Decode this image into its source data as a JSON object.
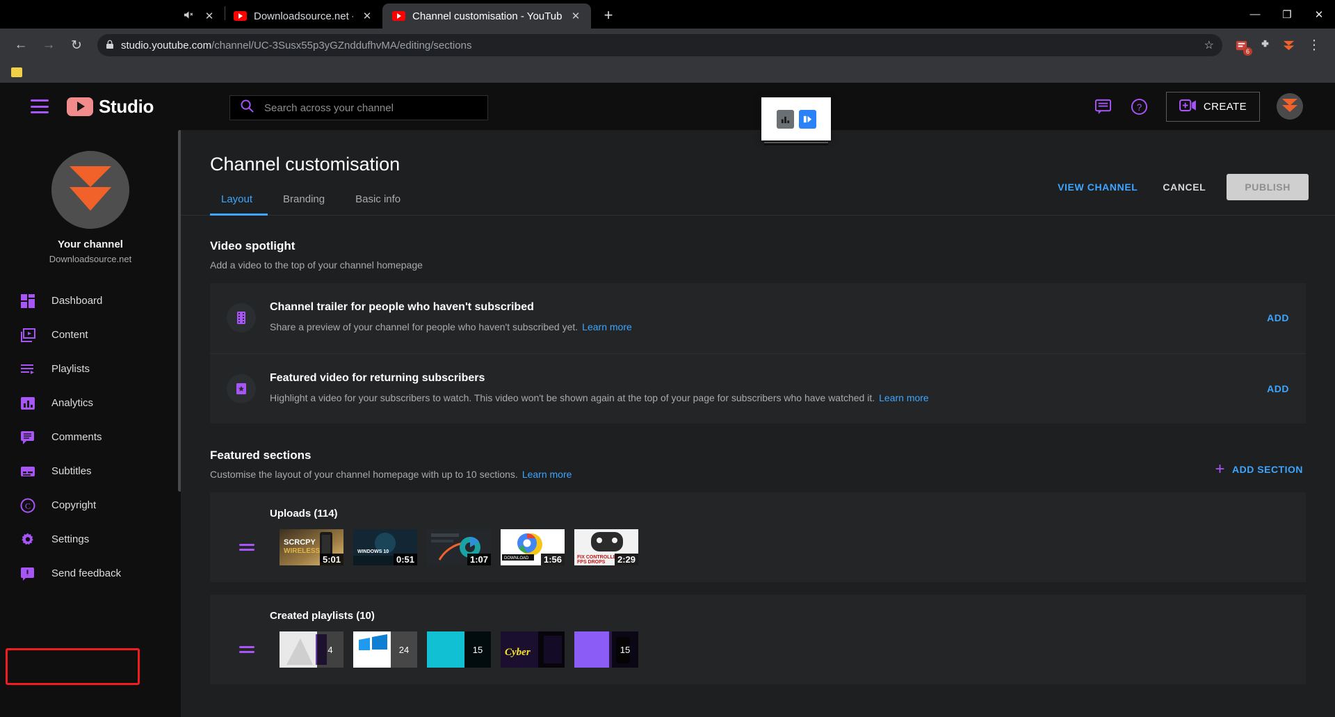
{
  "browser": {
    "tabs": [
      {
        "title": "Downloadsource.net - YouTube",
        "active": false,
        "muted": true
      },
      {
        "title": "Channel customisation - YouTube",
        "active": true,
        "muted": false
      }
    ],
    "new_tab_label": "+",
    "window_controls": {
      "minimize": "—",
      "maximize": "❐",
      "close": "✕"
    },
    "nav": {
      "back": "←",
      "forward": "→",
      "reload": "↻"
    },
    "omnibox": {
      "lock": "🔒",
      "domain": "studio.youtube.com",
      "path": "/channel/UC-3Susx55p3yGZnddufhvMA/editing/sections",
      "star": "☆"
    },
    "extension_badge_count": "6",
    "menu": "⋮"
  },
  "header": {
    "logo_text": "Studio",
    "search": {
      "placeholder": "Search across your channel",
      "value": ""
    },
    "create_label": "CREATE",
    "icons": [
      "comment-icon",
      "help-icon"
    ]
  },
  "sidebar": {
    "your_channel_label": "Your channel",
    "channel_name": "Downloadsource.net",
    "items": [
      {
        "label": "Dashboard",
        "icon": "dashboard-icon"
      },
      {
        "label": "Content",
        "icon": "content-icon"
      },
      {
        "label": "Playlists",
        "icon": "playlists-icon"
      },
      {
        "label": "Analytics",
        "icon": "analytics-icon"
      },
      {
        "label": "Comments",
        "icon": "comments-icon"
      },
      {
        "label": "Subtitles",
        "icon": "subtitles-icon"
      },
      {
        "label": "Copyright",
        "icon": "copyright-icon"
      },
      {
        "label": "Settings",
        "icon": "settings-gear-icon"
      },
      {
        "label": "Send feedback",
        "icon": "feedback-icon"
      }
    ]
  },
  "main": {
    "page_title": "Channel customisation",
    "tabs": [
      {
        "label": "Layout",
        "active": true
      },
      {
        "label": "Branding",
        "active": false
      },
      {
        "label": "Basic info",
        "active": false
      }
    ],
    "actions": {
      "view_channel": "VIEW CHANNEL",
      "cancel": "CANCEL",
      "publish": "PUBLISH"
    },
    "video_spotlight": {
      "title": "Video spotlight",
      "subtitle": "Add a video to the top of your channel homepage",
      "cards": [
        {
          "title": "Channel trailer for people who haven't subscribed",
          "desc": "Share a preview of your channel for people who haven't subscribed yet.",
          "learn_more": "Learn more",
          "action": "ADD",
          "icon": "film-strip-icon"
        },
        {
          "title": "Featured video for returning subscribers",
          "desc": "Highlight a video for your subscribers to watch. This video won't be shown again at the top of your page for subscribers who have watched it.",
          "learn_more": "Learn more",
          "action": "ADD",
          "icon": "featured-video-icon"
        }
      ]
    },
    "featured_sections": {
      "title": "Featured sections",
      "subtitle": "Customise the layout of your channel homepage with up to 10 sections.",
      "learn_more": "Learn more",
      "add_section": "ADD SECTION",
      "sections": [
        {
          "name": "Uploads (114)",
          "items": [
            {
              "duration": "5:01",
              "label": "SCRCPY WIRELESS"
            },
            {
              "duration": "0:51",
              "label": "WINDOWS 10"
            },
            {
              "duration": "1:07",
              "label": ""
            },
            {
              "duration": "1:56",
              "label": ""
            },
            {
              "duration": "2:29",
              "label": "FIX CONTROLLER FPS DROPS"
            }
          ]
        },
        {
          "name": "Created playlists (10)",
          "items": [
            {
              "count": "4",
              "label": ""
            },
            {
              "count": "24",
              "label": ""
            },
            {
              "count": "15",
              "label": ""
            },
            {
              "count": "",
              "label": ""
            },
            {
              "count": "15",
              "label": ""
            }
          ]
        }
      ]
    }
  },
  "colors": {
    "accent_blue": "#3ea6ff",
    "accent_purple": "#a855f7",
    "highlight_red": "#ef1d1d",
    "brand_orange": "#f1622a"
  }
}
